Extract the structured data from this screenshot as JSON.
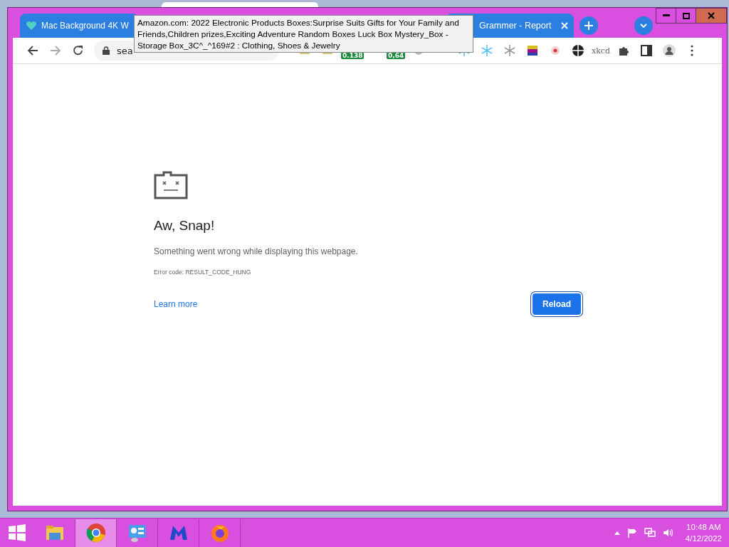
{
  "browser": {
    "tabs": [
      {
        "title": "Mac Background 4K W"
      },
      {
        "title": "Grammer - Report"
      }
    ],
    "tooltip": "Amazon.com: 2022 Electronic Products Boxes:Surprise Suits Gifts for Your Family and Friends,Children prizes,Exciting Adventure Random Boxes Luck Box Mystery_Box - Storage Box_3C^_^169#2 : Clothing, Shoes & Jewelry",
    "address_bar": {
      "url": "sea"
    },
    "extension_badges": [
      "0.138",
      "0,64"
    ],
    "extension_text_icon": "xkcd"
  },
  "page": {
    "title": "Aw, Snap!",
    "message": "Something went wrong while displaying this webpage.",
    "error_code": "Error code: RESULT_CODE_HUNG",
    "link": "Learn more",
    "button": "Reload"
  },
  "taskbar": {
    "apps": [
      {
        "kind": "folder",
        "selected": false
      },
      {
        "kind": "chrome",
        "selected": true
      },
      {
        "kind": "panel",
        "selected": false
      },
      {
        "kind": "shield",
        "selected": false
      },
      {
        "kind": "firefox",
        "selected": false
      }
    ],
    "time": "10:48 AM",
    "date": "4/12/2022"
  }
}
